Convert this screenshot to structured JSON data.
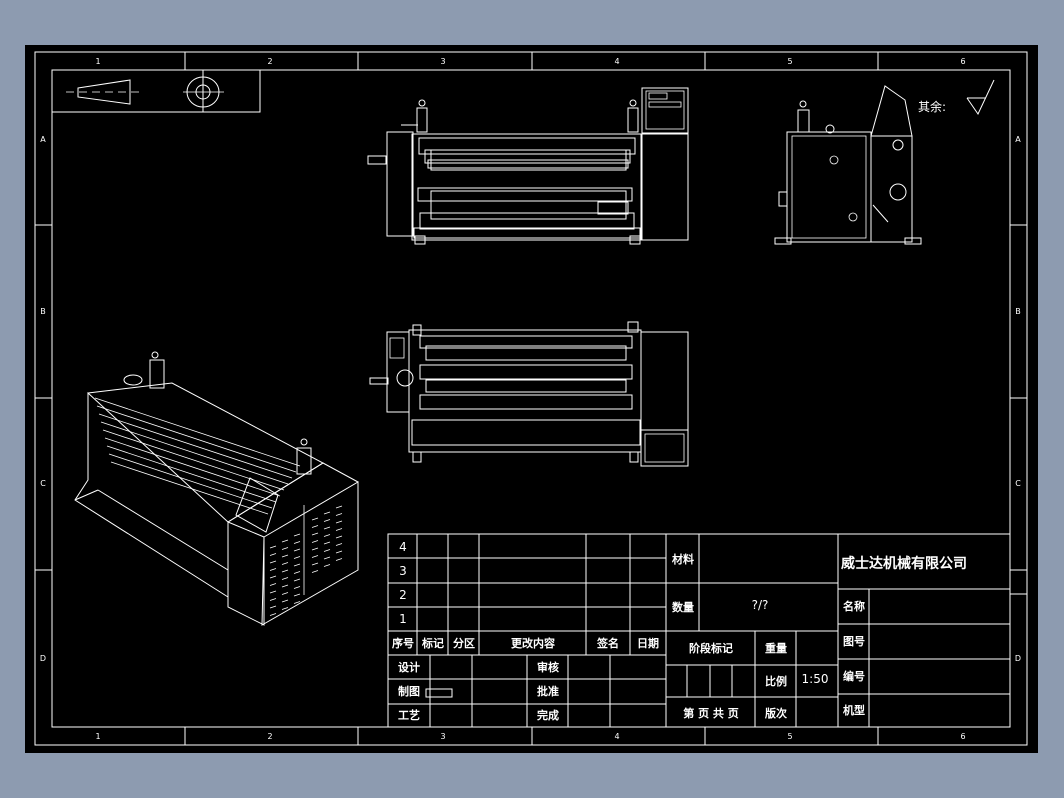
{
  "colors": {
    "background": "#8d9bb0",
    "paper": "#000000",
    "lines": "#ffffff"
  },
  "zones": {
    "columns": [
      "1",
      "2",
      "3",
      "4",
      "5",
      "6"
    ],
    "rows": [
      "A",
      "B",
      "C",
      "D"
    ]
  },
  "surface_finish": {
    "label": "其余:",
    "icon": "roughness-symbol-icon"
  },
  "projection_symbol": {
    "icon": "first-angle-projection-icon"
  },
  "title_block": {
    "revision_rows": [
      "4",
      "3",
      "2",
      "1"
    ],
    "revision_headers": {
      "seq": "序号",
      "mark": "标记",
      "zone": "分区",
      "change": "更改内容",
      "sign": "签名",
      "date": "日期"
    },
    "roles": {
      "design": "设计",
      "drawing": "制图",
      "process": "工艺",
      "review": "审核",
      "approve": "批准",
      "complete": "完成"
    },
    "material_label": "材料",
    "quantity_label": "数量",
    "quantity_value": "?/?",
    "stage_mark_label": "阶段标记",
    "weight_label": "重量",
    "scale_label": "比例",
    "scale_value": "1:50",
    "page_label": "第 页 共 页",
    "version_label": "版次",
    "company": "威士达机械有限公司",
    "name_label": "名称",
    "drawing_no_label": "图号",
    "code_label": "编号",
    "model_label": "机型"
  }
}
